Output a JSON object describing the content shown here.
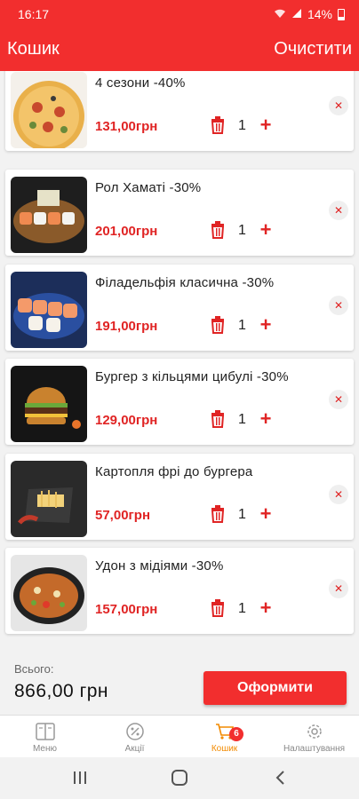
{
  "status_bar": {
    "time": "16:17",
    "battery": "14%"
  },
  "app_bar": {
    "title": "Кошик",
    "clear_label": "Очистити"
  },
  "cart": {
    "items": [
      {
        "name": "4 сезони -40%",
        "price": "131,00грн",
        "qty": "1",
        "remove": "✕"
      },
      {
        "name": "Рол Хаматі -30%",
        "price": "201,00грн",
        "qty": "1",
        "remove": "✕"
      },
      {
        "name": "Філадельфія класична -30%",
        "price": "191,00грн",
        "qty": "1",
        "remove": "✕"
      },
      {
        "name": "Бургер з кільцями цибулі -30%",
        "price": "129,00грн",
        "qty": "1",
        "remove": "✕"
      },
      {
        "name": "Картопля фрі до бургера",
        "price": "57,00грн",
        "qty": "1",
        "remove": "✕"
      },
      {
        "name": "Удон з мідіями -30%",
        "price": "157,00грн",
        "qty": "1",
        "remove": "✕"
      }
    ],
    "plus_label": "+"
  },
  "total": {
    "label": "Всього:",
    "value": "866,00 грн",
    "checkout_label": "Оформити"
  },
  "bottom_nav": {
    "items": [
      {
        "label": "Меню",
        "icon": "menu-book-icon"
      },
      {
        "label": "Акції",
        "icon": "percent-icon"
      },
      {
        "label": "Кошик",
        "icon": "cart-icon",
        "badge": "6",
        "active": true
      },
      {
        "label": "Налаштування",
        "icon": "gear-icon"
      }
    ]
  },
  "colors": {
    "primary": "#f22e2e",
    "price": "#e02424",
    "active_nav": "#f28a00"
  }
}
